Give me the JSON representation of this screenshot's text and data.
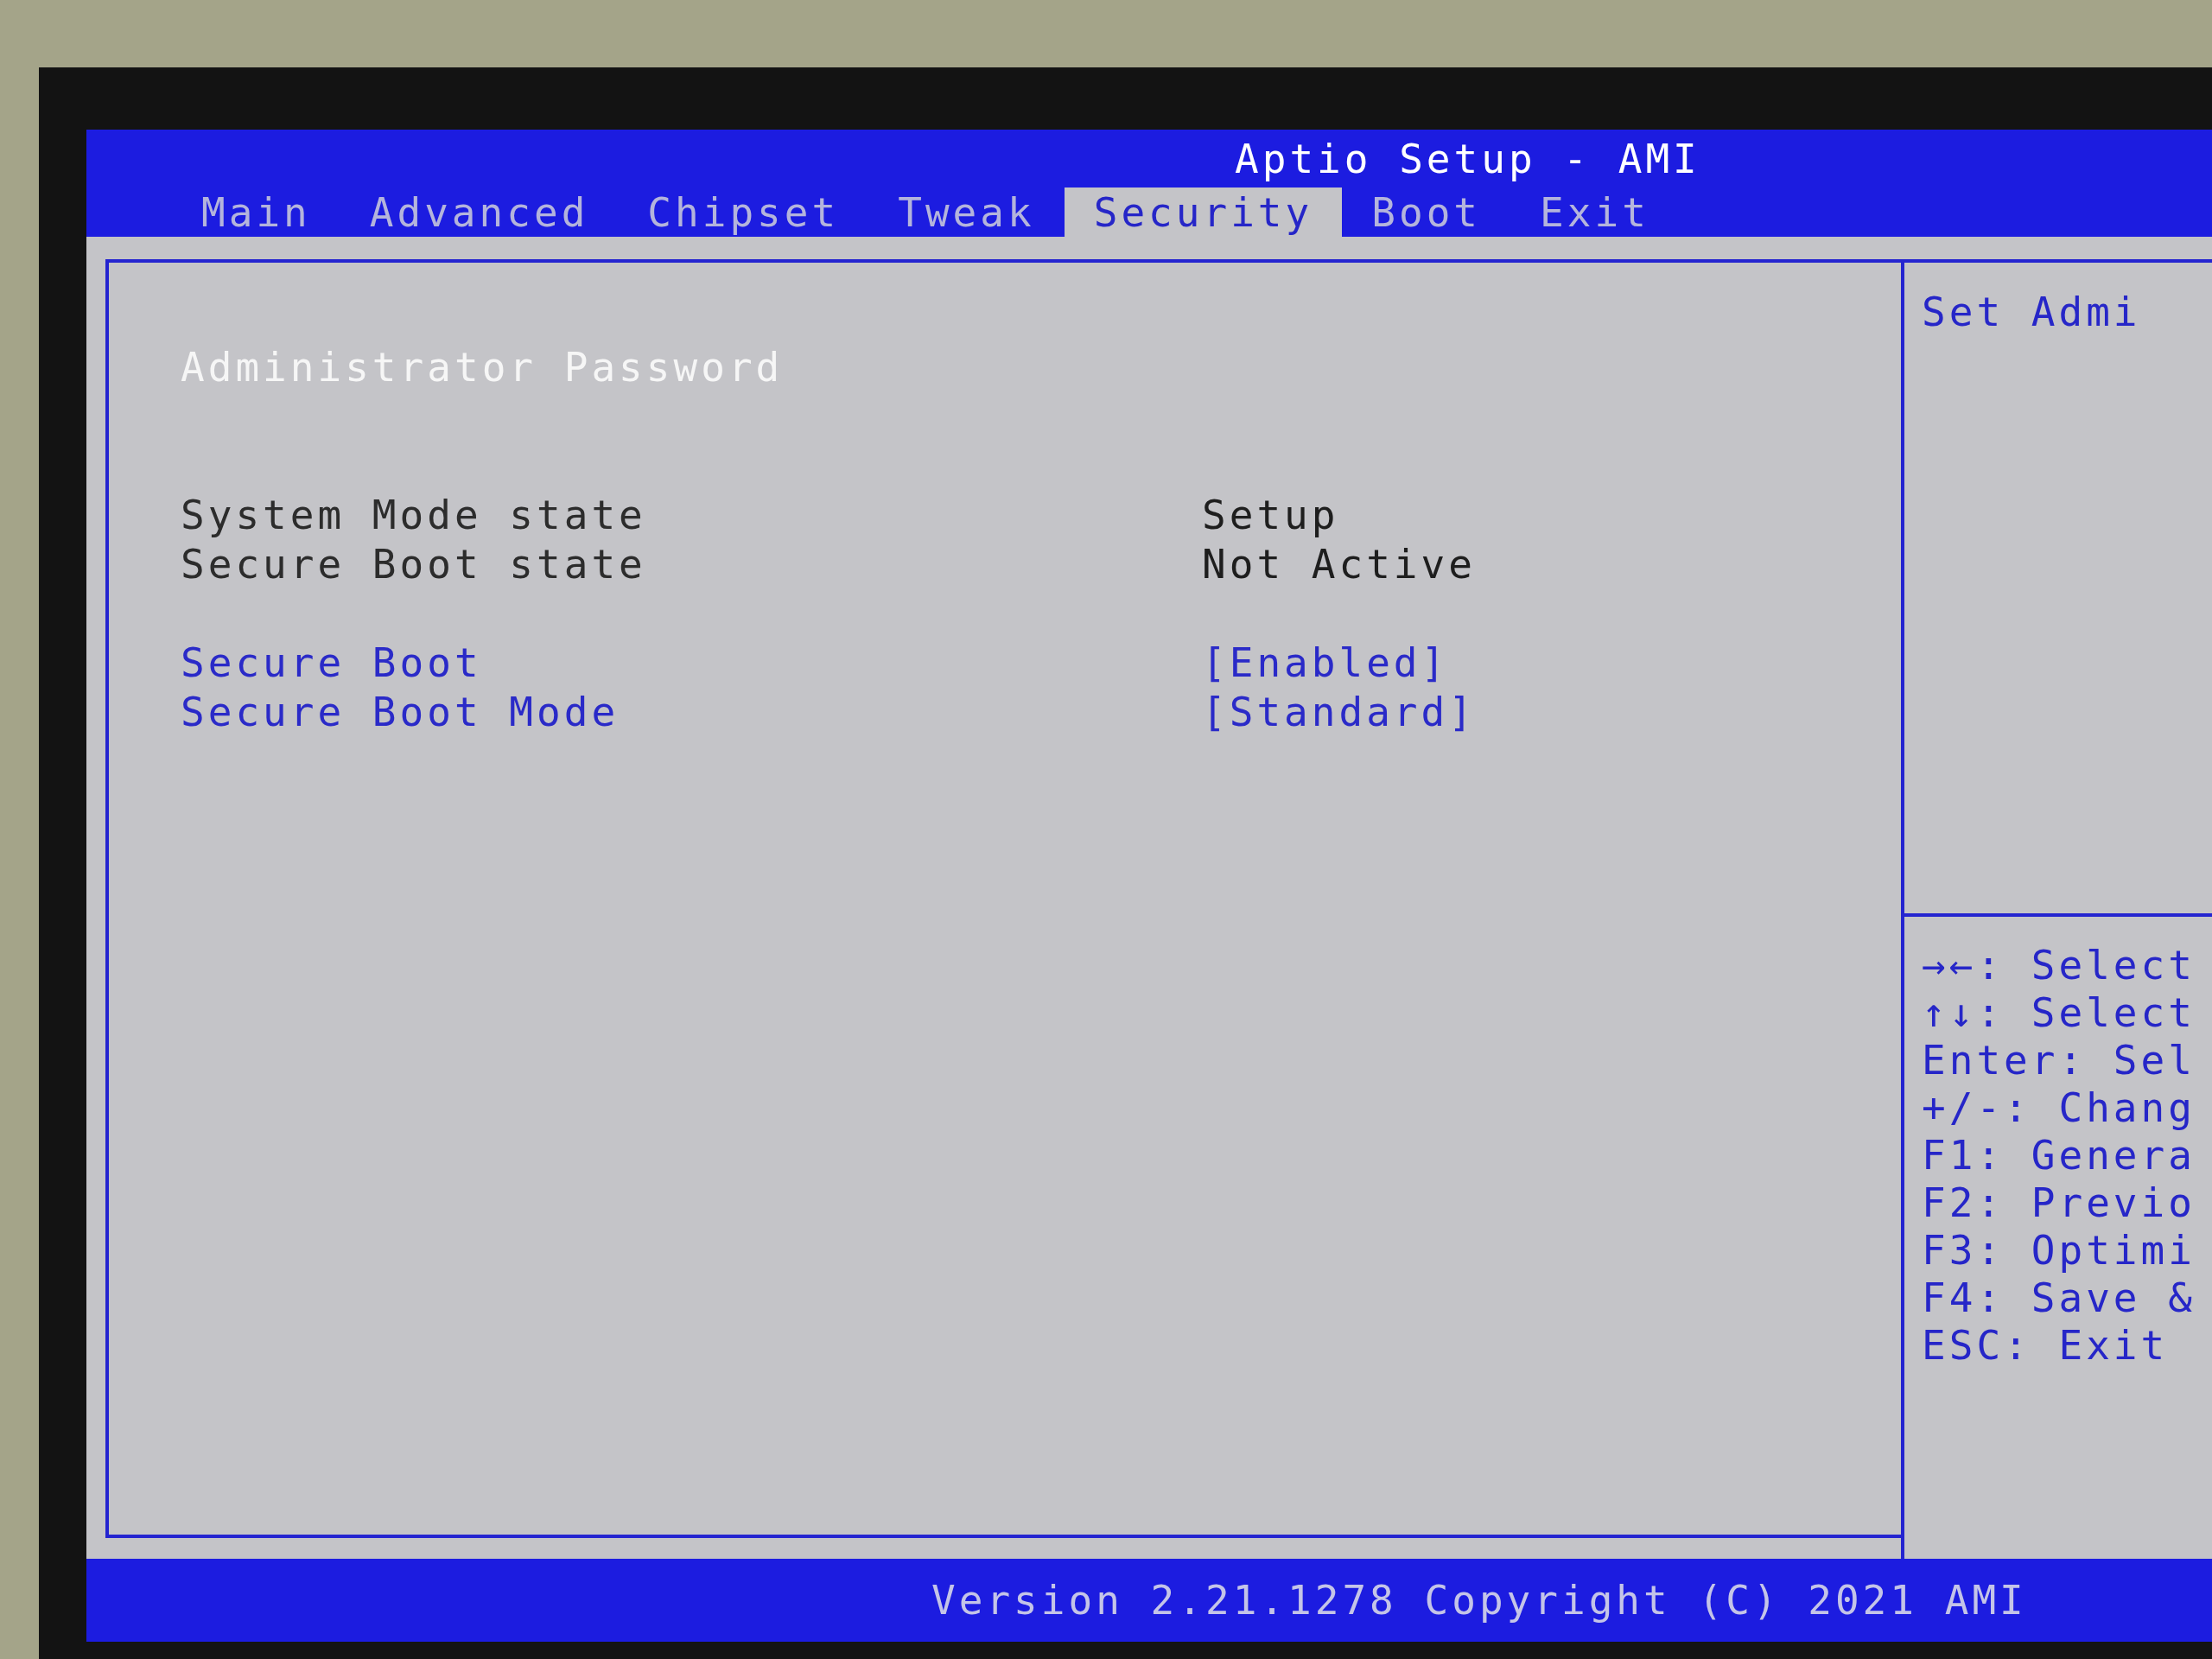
{
  "window": {
    "title": "Aptio Setup - AMI"
  },
  "tabs": [
    {
      "label": "Main",
      "selected": false
    },
    {
      "label": "Advanced",
      "selected": false
    },
    {
      "label": "Chipset",
      "selected": false
    },
    {
      "label": "Tweak",
      "selected": false
    },
    {
      "label": "Security",
      "selected": true
    },
    {
      "label": "Boot",
      "selected": false
    },
    {
      "label": "Exit",
      "selected": false
    }
  ],
  "main_panel": {
    "sections": [
      {
        "items": [
          {
            "kind": "option",
            "label": "Administrator Password",
            "selected": true
          }
        ]
      },
      {
        "items": [
          {
            "kind": "info",
            "label": "System Mode state",
            "value": "Setup"
          },
          {
            "kind": "info",
            "label": "Secure Boot state",
            "value": "Not Active"
          }
        ]
      },
      {
        "items": [
          {
            "kind": "option",
            "label": "Secure Boot",
            "value": "[Enabled]",
            "selected": false
          },
          {
            "kind": "option",
            "label": "Secure Boot Mode",
            "value": "[Standard]",
            "selected": false
          }
        ]
      }
    ]
  },
  "help_panel": {
    "description": "Set Admi",
    "keys": [
      "→←: Select",
      "↑↓: Select",
      "Enter: Sel",
      "+/-: Chang",
      "F1: Genera",
      "F2: Previo",
      "F3: Optimi",
      "F4: Save &",
      "ESC: Exit"
    ]
  },
  "status_bar": {
    "text": "Version 2.21.1278 Copyright (C) 2021 AMI"
  }
}
